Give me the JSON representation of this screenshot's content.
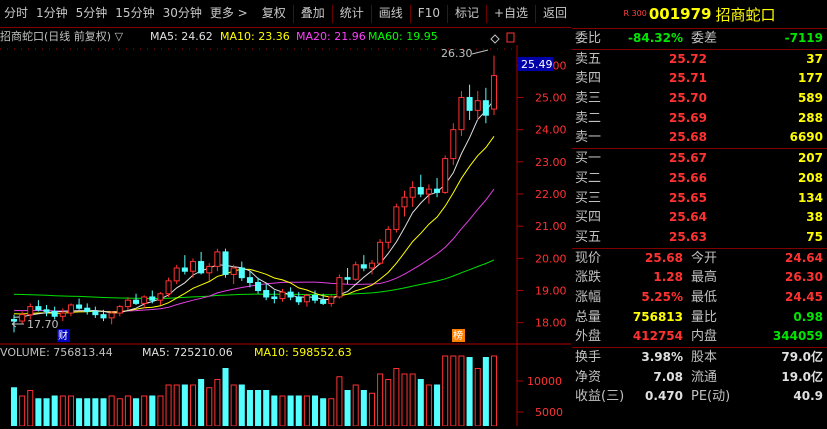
{
  "toolbar": {
    "periods": [
      "分时",
      "1分钟",
      "5分钟",
      "15分钟",
      "30分钟",
      "更多 >"
    ],
    "tools": [
      "复权",
      "叠加",
      "统计",
      "画线",
      "F10",
      "标记",
      "+自选",
      "返回"
    ]
  },
  "kline": {
    "header": {
      "title": "招商蛇口(日线 前复权) ▽",
      "ma5": "MA5: 24.62",
      "ma10": "MA10: 23.36",
      "ma20": "MA20: 21.96",
      "ma60": "MA60: 19.95"
    },
    "max_label": "26.30",
    "min_label": "17.70",
    "current_price_tag": "25.49",
    "y_ticks": [
      "26.00",
      "25.00",
      "24.00",
      "23.00",
      "22.00",
      "21.00",
      "20.00",
      "19.00",
      "18.00"
    ],
    "markers": {
      "cai": "财",
      "bang": "榜"
    }
  },
  "volume": {
    "header": {
      "volume": "VOLUME: 756813.44",
      "ma5": "MA5: 725210.06",
      "ma10": "MA10: 598552.63"
    },
    "y_ticks": [
      "10000",
      "5000"
    ]
  },
  "chart_data": {
    "type": "candlestick",
    "title": "招商蛇口(日线 前复权)",
    "ylim": [
      17.4,
      26.6
    ],
    "candles": [
      [
        18.1,
        18.25,
        17.7,
        18.05
      ],
      [
        18.05,
        18.35,
        17.95,
        18.25
      ],
      [
        18.25,
        18.6,
        18.1,
        18.5
      ],
      [
        18.5,
        18.7,
        18.35,
        18.4
      ],
      [
        18.4,
        18.55,
        18.2,
        18.35
      ],
      [
        18.35,
        18.5,
        18.1,
        18.2
      ],
      [
        18.2,
        18.45,
        18.05,
        18.3
      ],
      [
        18.3,
        18.6,
        18.2,
        18.55
      ],
      [
        18.55,
        18.75,
        18.4,
        18.45
      ],
      [
        18.45,
        18.6,
        18.25,
        18.35
      ],
      [
        18.35,
        18.5,
        18.15,
        18.25
      ],
      [
        18.25,
        18.4,
        18.05,
        18.15
      ],
      [
        18.15,
        18.35,
        17.95,
        18.3
      ],
      [
        18.3,
        18.55,
        18.2,
        18.5
      ],
      [
        18.5,
        18.8,
        18.4,
        18.7
      ],
      [
        18.7,
        18.9,
        18.55,
        18.6
      ],
      [
        18.6,
        18.85,
        18.45,
        18.8
      ],
      [
        18.8,
        19.0,
        18.6,
        18.7
      ],
      [
        18.7,
        18.95,
        18.55,
        18.9
      ],
      [
        18.9,
        19.4,
        18.8,
        19.3
      ],
      [
        19.3,
        19.8,
        19.2,
        19.7
      ],
      [
        19.7,
        20.1,
        19.5,
        19.6
      ],
      [
        19.6,
        20.0,
        19.4,
        19.9
      ],
      [
        19.9,
        20.2,
        19.5,
        19.55
      ],
      [
        19.55,
        19.85,
        19.3,
        19.75
      ],
      [
        19.75,
        20.3,
        19.6,
        20.2
      ],
      [
        20.2,
        20.3,
        19.4,
        19.5
      ],
      [
        19.5,
        19.8,
        19.2,
        19.7
      ],
      [
        19.7,
        19.9,
        19.3,
        19.4
      ],
      [
        19.4,
        19.6,
        19.1,
        19.25
      ],
      [
        19.25,
        19.4,
        18.9,
        19.0
      ],
      [
        19.0,
        19.2,
        18.7,
        18.8
      ],
      [
        18.8,
        19.0,
        18.6,
        18.75
      ],
      [
        18.75,
        19.05,
        18.65,
        18.95
      ],
      [
        18.95,
        19.1,
        18.7,
        18.8
      ],
      [
        18.8,
        18.95,
        18.55,
        18.65
      ],
      [
        18.65,
        18.9,
        18.5,
        18.85
      ],
      [
        18.85,
        19.0,
        18.6,
        18.7
      ],
      [
        18.7,
        18.9,
        18.55,
        18.6
      ],
      [
        18.6,
        18.85,
        18.5,
        18.8
      ],
      [
        18.8,
        19.5,
        18.75,
        19.4
      ],
      [
        19.4,
        19.7,
        19.2,
        19.35
      ],
      [
        19.35,
        19.9,
        19.3,
        19.8
      ],
      [
        19.8,
        20.1,
        19.6,
        19.7
      ],
      [
        19.7,
        19.95,
        19.5,
        19.85
      ],
      [
        19.85,
        20.6,
        19.8,
        20.5
      ],
      [
        20.5,
        21.0,
        20.3,
        20.9
      ],
      [
        20.9,
        21.7,
        20.8,
        21.6
      ],
      [
        21.6,
        22.1,
        21.3,
        21.9
      ],
      [
        21.9,
        22.4,
        21.6,
        22.2
      ],
      [
        22.2,
        22.6,
        21.9,
        22.0
      ],
      [
        22.0,
        22.3,
        21.7,
        22.15
      ],
      [
        22.15,
        22.5,
        21.9,
        22.05
      ],
      [
        22.05,
        23.2,
        22.0,
        23.1
      ],
      [
        23.1,
        24.2,
        22.9,
        24.0
      ],
      [
        24.0,
        25.2,
        23.8,
        25.0
      ],
      [
        25.0,
        25.4,
        24.3,
        24.6
      ],
      [
        24.6,
        25.2,
        24.3,
        24.9
      ],
      [
        24.9,
        25.3,
        24.2,
        24.45
      ],
      [
        24.64,
        26.3,
        24.45,
        25.68
      ]
    ]
  },
  "quote": {
    "market": "R 300",
    "code": "001979",
    "name": "招商蛇口",
    "weibi_label": "委比",
    "weibi": "-84.32%",
    "weicha_label": "委差",
    "weicha": "-7119",
    "asks": [
      {
        "label": "卖五",
        "price": "25.72",
        "vol": "37"
      },
      {
        "label": "卖四",
        "price": "25.71",
        "vol": "177"
      },
      {
        "label": "卖三",
        "price": "25.70",
        "vol": "589"
      },
      {
        "label": "卖二",
        "price": "25.69",
        "vol": "288"
      },
      {
        "label": "卖一",
        "price": "25.68",
        "vol": "6690"
      }
    ],
    "bids": [
      {
        "label": "买一",
        "price": "25.67",
        "vol": "207"
      },
      {
        "label": "买二",
        "price": "25.66",
        "vol": "208"
      },
      {
        "label": "买三",
        "price": "25.65",
        "vol": "134"
      },
      {
        "label": "买四",
        "price": "25.64",
        "vol": "38"
      },
      {
        "label": "买五",
        "price": "25.63",
        "vol": "75"
      }
    ],
    "stats": [
      {
        "l1": "现价",
        "v1": "25.68",
        "c1": "red",
        "l2": "今开",
        "v2": "24.64",
        "c2": "red"
      },
      {
        "l1": "涨跌",
        "v1": "1.28",
        "c1": "red",
        "l2": "最高",
        "v2": "26.30",
        "c2": "red"
      },
      {
        "l1": "涨幅",
        "v1": "5.25%",
        "c1": "red",
        "l2": "最低",
        "v2": "24.45",
        "c2": "red"
      },
      {
        "l1": "总量",
        "v1": "756813",
        "c1": "yellow",
        "l2": "量比",
        "v2": "0.98",
        "c2": "green"
      },
      {
        "l1": "外盘",
        "v1": "412754",
        "c1": "red",
        "l2": "内盘",
        "v2": "344059",
        "c2": "green"
      }
    ],
    "fin": [
      {
        "l1": "换手",
        "v1": "3.98%",
        "l2": "股本",
        "v2": "79.0亿"
      },
      {
        "l1": "净资",
        "v1": "7.08",
        "l2": "流通",
        "v2": "19.0亿"
      },
      {
        "l1": "收益(三)",
        "v1": "0.470",
        "l2": "PE(动)",
        "v2": "40.9"
      }
    ]
  }
}
